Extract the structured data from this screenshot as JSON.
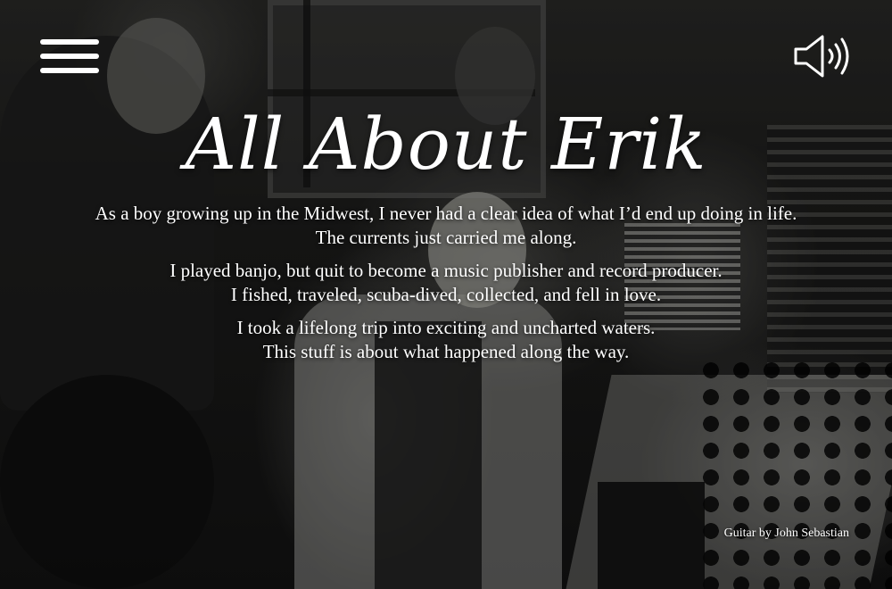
{
  "header": {
    "menu_icon": "hamburger-menu-icon",
    "sound_icon": "speaker-volume-icon"
  },
  "hero": {
    "title": "All About Erik",
    "paragraphs": [
      {
        "line1": "As a boy growing up in the Midwest, I never had a clear idea of what I’d end up doing in life.",
        "line2": "The currents just carried me along."
      },
      {
        "line1": "I played banjo, but quit to become a music publisher and record producer.",
        "line2": "I fished, traveled, scuba-dived, collected, and fell in love."
      },
      {
        "line1": "I took a lifelong trip into exciting and uncharted waters.",
        "line2": "This stuff is about what happened along the way."
      }
    ],
    "audio_credit": "Guitar by John Sebastian"
  },
  "colors": {
    "text": "#ffffff",
    "background": "#111111"
  }
}
